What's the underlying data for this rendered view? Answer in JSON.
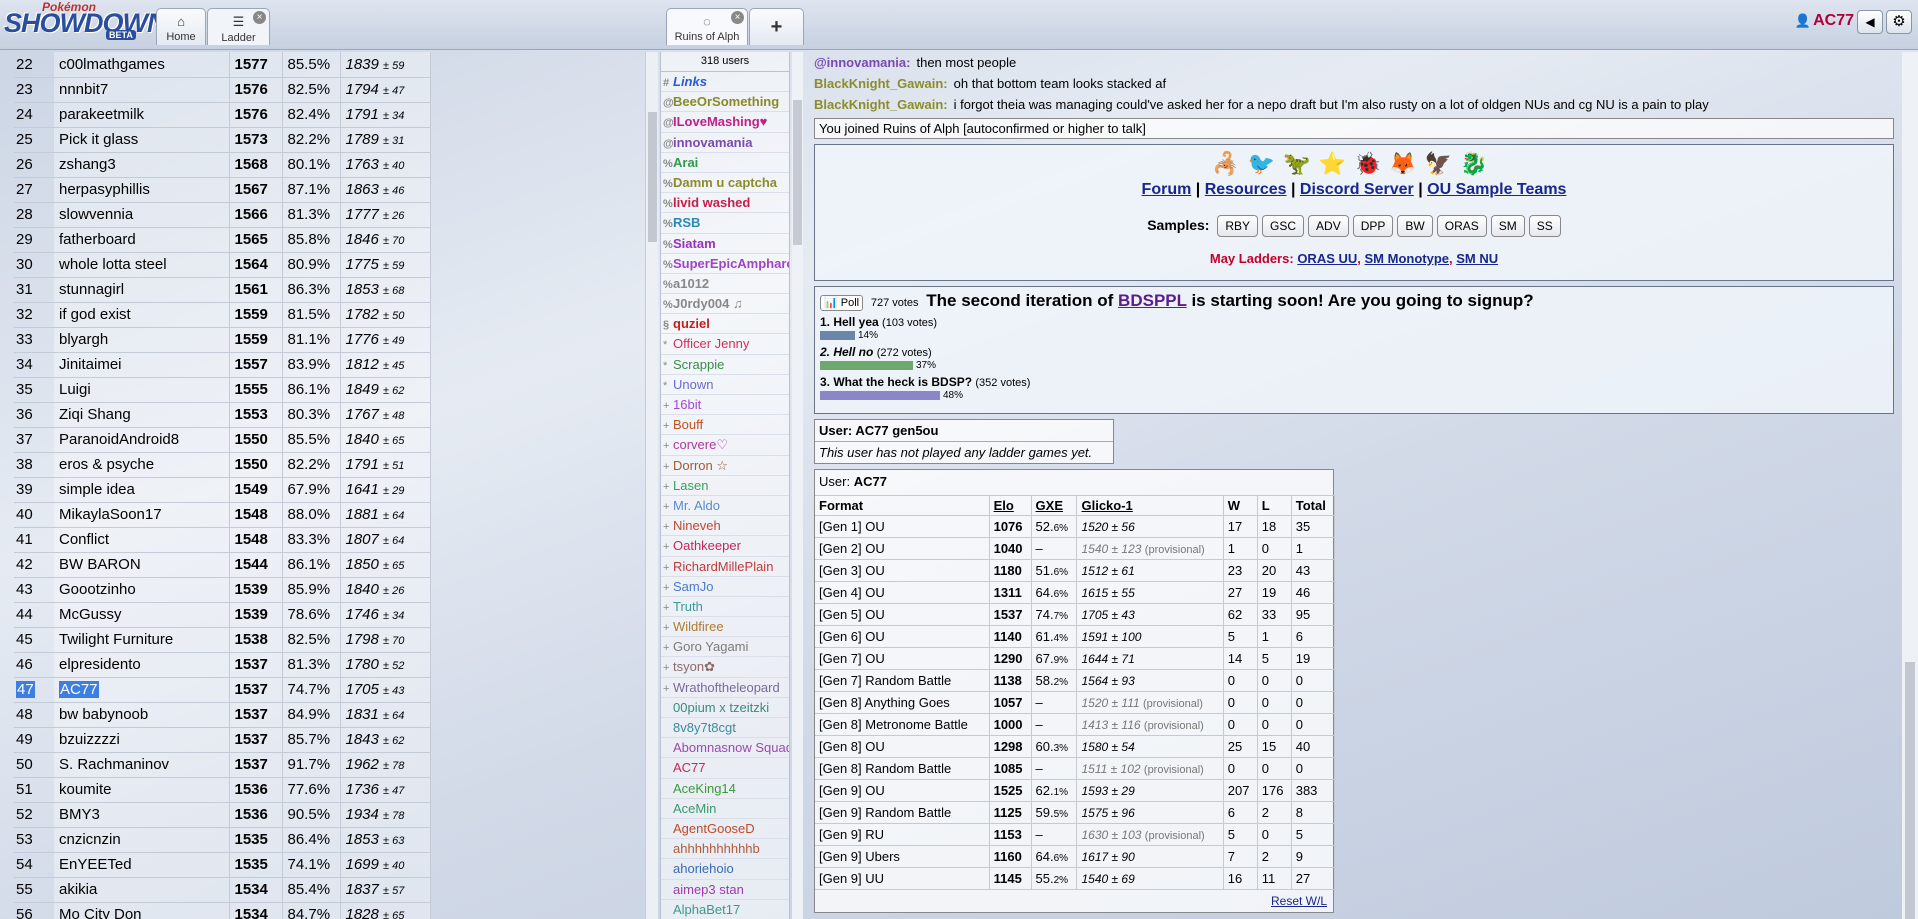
{
  "header": {
    "logo": {
      "pokemon": "Pokémon",
      "showdown": "SHOWDOWN",
      "beta": "BETA"
    },
    "tabs": {
      "home": {
        "icon": "⌂",
        "label": "Home"
      },
      "ladder": {
        "icon": "☰",
        "label": "Ladder",
        "close": "×"
      },
      "room": {
        "icon": "◌",
        "label": "Ruins of Alph",
        "close": "×"
      },
      "new_tab": "+"
    },
    "username": "AC77",
    "volume_icon": "◀",
    "gear_icon": "⚙"
  },
  "ladder": {
    "rows": [
      {
        "rank": "22",
        "name": "c00lmathgames",
        "elo": "1577",
        "gxe": "85.5%",
        "glicko": "1839",
        "dev": "± 59"
      },
      {
        "rank": "23",
        "name": "nnnbit7",
        "elo": "1576",
        "gxe": "82.5%",
        "glicko": "1794",
        "dev": "± 47"
      },
      {
        "rank": "24",
        "name": "parakeetmilk",
        "elo": "1576",
        "gxe": "82.4%",
        "glicko": "1791",
        "dev": "± 34"
      },
      {
        "rank": "25",
        "name": "Pick it glass",
        "elo": "1573",
        "gxe": "82.2%",
        "glicko": "1789",
        "dev": "± 31"
      },
      {
        "rank": "26",
        "name": "zshang3",
        "elo": "1568",
        "gxe": "80.1%",
        "glicko": "1763",
        "dev": "± 40"
      },
      {
        "rank": "27",
        "name": "herpasyphillis",
        "elo": "1567",
        "gxe": "87.1%",
        "glicko": "1863",
        "dev": "± 46"
      },
      {
        "rank": "28",
        "name": "slowvennia",
        "elo": "1566",
        "gxe": "81.3%",
        "glicko": "1777",
        "dev": "± 26"
      },
      {
        "rank": "29",
        "name": "fatherboard",
        "elo": "1565",
        "gxe": "85.8%",
        "glicko": "1846",
        "dev": "± 70"
      },
      {
        "rank": "30",
        "name": "whole lotta steel",
        "elo": "1564",
        "gxe": "80.9%",
        "glicko": "1775",
        "dev": "± 59"
      },
      {
        "rank": "31",
        "name": "stunnagirl",
        "elo": "1561",
        "gxe": "86.3%",
        "glicko": "1853",
        "dev": "± 68"
      },
      {
        "rank": "32",
        "name": "if god exist",
        "elo": "1559",
        "gxe": "81.5%",
        "glicko": "1782",
        "dev": "± 50"
      },
      {
        "rank": "33",
        "name": "blyargh",
        "elo": "1559",
        "gxe": "81.1%",
        "glicko": "1776",
        "dev": "± 49"
      },
      {
        "rank": "34",
        "name": "Jinitaimei",
        "elo": "1557",
        "gxe": "83.9%",
        "glicko": "1812",
        "dev": "± 45"
      },
      {
        "rank": "35",
        "name": "Luigi",
        "elo": "1555",
        "gxe": "86.1%",
        "glicko": "1849",
        "dev": "± 62"
      },
      {
        "rank": "36",
        "name": "Ziqi Shang",
        "elo": "1553",
        "gxe": "80.3%",
        "glicko": "1767",
        "dev": "± 48"
      },
      {
        "rank": "37",
        "name": "ParanoidAndroid8",
        "elo": "1550",
        "gxe": "85.5%",
        "glicko": "1840",
        "dev": "± 65"
      },
      {
        "rank": "38",
        "name": "eros & psyche",
        "elo": "1550",
        "gxe": "82.2%",
        "glicko": "1791",
        "dev": "± 51"
      },
      {
        "rank": "39",
        "name": "simple idea",
        "elo": "1549",
        "gxe": "67.9%",
        "glicko": "1641",
        "dev": "± 29"
      },
      {
        "rank": "40",
        "name": "MikaylaSoon17",
        "elo": "1548",
        "gxe": "88.0%",
        "glicko": "1881",
        "dev": "± 64"
      },
      {
        "rank": "41",
        "name": "Conflict",
        "elo": "1548",
        "gxe": "83.3%",
        "glicko": "1807",
        "dev": "± 64"
      },
      {
        "rank": "42",
        "name": "BW BARON",
        "elo": "1544",
        "gxe": "86.1%",
        "glicko": "1850",
        "dev": "± 65"
      },
      {
        "rank": "43",
        "name": "Goootzinho",
        "elo": "1539",
        "gxe": "85.9%",
        "glicko": "1840",
        "dev": "± 26"
      },
      {
        "rank": "44",
        "name": "McGussy",
        "elo": "1539",
        "gxe": "78.6%",
        "glicko": "1746",
        "dev": "± 34"
      },
      {
        "rank": "45",
        "name": "Twilight Furniture",
        "elo": "1538",
        "gxe": "82.5%",
        "glicko": "1798",
        "dev": "± 70"
      },
      {
        "rank": "46",
        "name": "elpresidento",
        "elo": "1537",
        "gxe": "81.3%",
        "glicko": "1780",
        "dev": "± 52"
      },
      {
        "rank": "47",
        "name": "AC77",
        "elo": "1537",
        "gxe": "74.7%",
        "glicko": "1705",
        "dev": "± 43"
      },
      {
        "rank": "48",
        "name": "bw babynoob",
        "elo": "1537",
        "gxe": "84.9%",
        "glicko": "1831",
        "dev": "± 64"
      },
      {
        "rank": "49",
        "name": "bzuizzzzi",
        "elo": "1537",
        "gxe": "85.7%",
        "glicko": "1843",
        "dev": "± 62"
      },
      {
        "rank": "50",
        "name": "S. Rachmaninov",
        "elo": "1537",
        "gxe": "91.7%",
        "glicko": "1962",
        "dev": "± 78"
      },
      {
        "rank": "51",
        "name": "koumite",
        "elo": "1536",
        "gxe": "77.6%",
        "glicko": "1736",
        "dev": "± 47"
      },
      {
        "rank": "52",
        "name": "BMY3",
        "elo": "1536",
        "gxe": "90.5%",
        "glicko": "1934",
        "dev": "± 78"
      },
      {
        "rank": "53",
        "name": "cnzicnzin",
        "elo": "1535",
        "gxe": "86.4%",
        "glicko": "1853",
        "dev": "± 63"
      },
      {
        "rank": "54",
        "name": "EnYEETed",
        "elo": "1535",
        "gxe": "74.1%",
        "glicko": "1699",
        "dev": "± 40"
      },
      {
        "rank": "55",
        "name": "akikia",
        "elo": "1534",
        "gxe": "85.4%",
        "glicko": "1837",
        "dev": "± 57"
      },
      {
        "rank": "56",
        "name": "Mo City Don",
        "elo": "1534",
        "gxe": "84.7%",
        "glicko": "1828",
        "dev": "± 65"
      }
    ],
    "highlight_rank": "47"
  },
  "userlist": {
    "count": "318 users",
    "users": [
      {
        "g": "#",
        "name": "Links",
        "color": "#2a5bd6",
        "b": true,
        "i": true
      },
      {
        "g": "@",
        "name": "BeeOrSomething",
        "color": "#8a8a26",
        "b": true
      },
      {
        "g": "@",
        "name": "ILoveMashing♥",
        "color": "#c0208a",
        "b": true
      },
      {
        "g": "@",
        "name": "innovamania",
        "color": "#7a4ab0",
        "b": true
      },
      {
        "g": "%",
        "name": "Arai",
        "color": "#2f9a4e",
        "b": true
      },
      {
        "g": "%",
        "name": "Damm u captcha",
        "color": "#8c8c2a",
        "b": true
      },
      {
        "g": "%",
        "name": "livid washed",
        "color": "#c41e4a",
        "b": true
      },
      {
        "g": "%",
        "name": "RSB",
        "color": "#2a8ab0",
        "b": true
      },
      {
        "g": "%",
        "name": "Siatam",
        "color": "#9a30b8",
        "b": true
      },
      {
        "g": "%",
        "name": "SuperEpicAmpharos",
        "color": "#a044c4",
        "b": true
      },
      {
        "g": "%",
        "name": "a1012",
        "color": "#888888",
        "b": true
      },
      {
        "g": "%",
        "name": "J0rdy004 ♫",
        "color": "#888888",
        "b": true
      },
      {
        "g": "§",
        "name": "quziel",
        "color": "#c41e1e",
        "b": true
      },
      {
        "g": "*",
        "name": "Officer Jenny",
        "color": "#d0305a",
        "b": false
      },
      {
        "g": "*",
        "name": "Scrappie",
        "color": "#3a8a4a",
        "b": false
      },
      {
        "g": "*",
        "name": "Unown",
        "color": "#6a6ad0",
        "b": false
      },
      {
        "g": "+",
        "name": "16bit",
        "color": "#a04ad0",
        "b": false
      },
      {
        "g": "+",
        "name": "Bouff",
        "color": "#c05020",
        "b": false
      },
      {
        "g": "+",
        "name": "corvere♡",
        "color": "#b03a9a",
        "b": false
      },
      {
        "g": "+",
        "name": "Dorron ☆",
        "color": "#a05a30",
        "b": false
      },
      {
        "g": "+",
        "name": "Lasen",
        "color": "#3aa060",
        "b": false
      },
      {
        "g": "+",
        "name": "Mr. Aldo",
        "color": "#5a8ad0",
        "b": false
      },
      {
        "g": "+",
        "name": "Nineveh",
        "color": "#c04a30",
        "b": false
      },
      {
        "g": "+",
        "name": "Oathkeeper",
        "color": "#c02a5a",
        "b": false
      },
      {
        "g": "+",
        "name": "RichardMillePlain",
        "color": "#c03a3a",
        "b": false
      },
      {
        "g": "+",
        "name": "SamJo",
        "color": "#4a7ad0",
        "b": false
      },
      {
        "g": "+",
        "name": "Truth",
        "color": "#3a9a9a",
        "b": false
      },
      {
        "g": "+",
        "name": "Wildfiree",
        "color": "#b07a30",
        "b": false
      },
      {
        "g": "+",
        "name": "Goro Yagami",
        "color": "#7a7a7a",
        "b": false
      },
      {
        "g": "+",
        "name": "tsyon✿",
        "color": "#8a6a6a",
        "b": false
      },
      {
        "g": "+",
        "name": "Wrathoftheleopard",
        "color": "#7a6a9a",
        "b": false
      },
      {
        "g": " ",
        "name": "00pium x tzeitzki",
        "color": "#3a8a7a",
        "b": false
      },
      {
        "g": " ",
        "name": "8v8y7t8cgt",
        "color": "#3a8aa0",
        "b": false
      },
      {
        "g": " ",
        "name": "Abomnasnow Squad",
        "color": "#9a4ab0",
        "b": false
      },
      {
        "g": " ",
        "name": "AC77",
        "color": "#c02a5a",
        "b": false
      },
      {
        "g": " ",
        "name": "AceKing14",
        "color": "#3a9a3a",
        "b": false
      },
      {
        "g": " ",
        "name": "AceMin",
        "color": "#3a9a6a",
        "b": false
      },
      {
        "g": " ",
        "name": "AgentGooseD",
        "color": "#c04a2a",
        "b": false
      },
      {
        "g": " ",
        "name": "ahhhhhhhhhhb",
        "color": "#b05a3a",
        "b": false
      },
      {
        "g": " ",
        "name": "ahoriehoio",
        "color": "#3a6ab0",
        "b": false
      },
      {
        "g": " ",
        "name": "aimep3 stan",
        "color": "#a03ab0",
        "b": false
      },
      {
        "g": " ",
        "name": "AlphaBet17",
        "color": "#3a9a8a",
        "b": false
      }
    ]
  },
  "chat": {
    "messages": [
      {
        "who": "@innovamania:",
        "color": "#7a4ab0",
        "text": "then most people"
      },
      {
        "who": "BlackKnight_Gawain:",
        "color": "#8c8c2a",
        "text": "oh that bottom team looks stacked af"
      },
      {
        "who": "BlackKnight_Gawain:",
        "color": "#8c8c2a",
        "text": "i forgot theia was managing could've asked her for a nepo draft but I'm also rusty on a lot of oldgen NUs and cg NU is a pain to play"
      }
    ],
    "joined_notice": "You joined Ruins of Alph [autoconfirmed or higher to talk]",
    "intro": {
      "sprites": [
        "🦂",
        "🐦",
        "🦖",
        "⭐",
        "🐞",
        "🦊",
        "🦅",
        "🐉"
      ],
      "links": [
        "Forum",
        "Resources",
        "Discord Server",
        "OU Sample Teams"
      ],
      "sep": "|",
      "samples_label": "Samples:",
      "samples": [
        "RBY",
        "GSC",
        "ADV",
        "DPP",
        "BW",
        "ORAS",
        "SM",
        "SS"
      ],
      "may_label": "May Ladders:",
      "may_links": [
        "ORAS UU",
        "SM Monotype",
        "SM NU"
      ],
      "comma": ","
    },
    "poll": {
      "badge": "📊 Poll",
      "votes": "727 votes",
      "q1": "The second iteration of",
      "q_link": "BDSPPL",
      "q2": "is starting soon! Are you going to signup?",
      "options": [
        {
          "label": "1. Hell yea",
          "votes": "(103 votes)",
          "pct": "14%",
          "frac": 0.14,
          "color": "#6a86a8",
          "italic": false
        },
        {
          "label": "2. Hell no",
          "votes": "(272 votes)",
          "pct": "37%",
          "frac": 0.37,
          "color": "#6fa86f",
          "italic": true
        },
        {
          "label": "3. What the heck is BDSP?",
          "votes": "(352 votes)",
          "pct": "48%",
          "frac": 0.48,
          "color": "#8a86c8",
          "italic": false
        }
      ]
    },
    "user_gen5ou": {
      "title": "User: AC77 gen5ou",
      "empty": "This user has not played any ladder games yet."
    },
    "stats": {
      "title_prefix": "User:",
      "title_user": "AC77",
      "headers": [
        "Format",
        "Elo",
        "GXE",
        "Glicko-1",
        "W",
        "L",
        "Total"
      ],
      "rows": [
        {
          "format": "[Gen 1] OU",
          "elo": "1076",
          "gxe": "52.",
          "gxe_dec": "6%",
          "gl": "1520 ± 56",
          "prov": "",
          "w": "17",
          "l": "18",
          "t": "35"
        },
        {
          "format": "[Gen 2] OU",
          "elo": "1040",
          "gxe": "–",
          "gxe_dec": "",
          "gl": "1540 ± 123",
          "prov": "(provisional)",
          "w": "1",
          "l": "0",
          "t": "1"
        },
        {
          "format": "[Gen 3] OU",
          "elo": "1180",
          "gxe": "51.",
          "gxe_dec": "6%",
          "gl": "1512 ± 61",
          "prov": "",
          "w": "23",
          "l": "20",
          "t": "43"
        },
        {
          "format": "[Gen 4] OU",
          "elo": "1311",
          "gxe": "64.",
          "gxe_dec": "6%",
          "gl": "1615 ± 55",
          "prov": "",
          "w": "27",
          "l": "19",
          "t": "46"
        },
        {
          "format": "[Gen 5] OU",
          "elo": "1537",
          "gxe": "74.",
          "gxe_dec": "7%",
          "gl": "1705 ± 43",
          "prov": "",
          "w": "62",
          "l": "33",
          "t": "95"
        },
        {
          "format": "[Gen 6] OU",
          "elo": "1140",
          "gxe": "61.",
          "gxe_dec": "4%",
          "gl": "1591 ± 100",
          "prov": "",
          "w": "5",
          "l": "1",
          "t": "6"
        },
        {
          "format": "[Gen 7] OU",
          "elo": "1290",
          "gxe": "67.",
          "gxe_dec": "9%",
          "gl": "1644 ± 71",
          "prov": "",
          "w": "14",
          "l": "5",
          "t": "19"
        },
        {
          "format": "[Gen 7] Random Battle",
          "elo": "1138",
          "gxe": "58.",
          "gxe_dec": "2%",
          "gl": "1564 ± 93",
          "prov": "",
          "w": "0",
          "l": "0",
          "t": "0"
        },
        {
          "format": "[Gen 8] Anything Goes",
          "elo": "1057",
          "gxe": "–",
          "gxe_dec": "",
          "gl": "1520 ± 111",
          "prov": "(provisional)",
          "w": "0",
          "l": "0",
          "t": "0"
        },
        {
          "format": "[Gen 8] Metronome Battle",
          "elo": "1000",
          "gxe": "–",
          "gxe_dec": "",
          "gl": "1413 ± 116",
          "prov": "(provisional)",
          "w": "0",
          "l": "0",
          "t": "0"
        },
        {
          "format": "[Gen 8] OU",
          "elo": "1298",
          "gxe": "60.",
          "gxe_dec": "3%",
          "gl": "1580 ± 54",
          "prov": "",
          "w": "25",
          "l": "15",
          "t": "40"
        },
        {
          "format": "[Gen 8] Random Battle",
          "elo": "1085",
          "gxe": "–",
          "gxe_dec": "",
          "gl": "1511 ± 102",
          "prov": "(provisional)",
          "w": "0",
          "l": "0",
          "t": "0"
        },
        {
          "format": "[Gen 9] OU",
          "elo": "1525",
          "gxe": "62.",
          "gxe_dec": "1%",
          "gl": "1593 ± 29",
          "prov": "",
          "w": "207",
          "l": "176",
          "t": "383"
        },
        {
          "format": "[Gen 9] Random Battle",
          "elo": "1125",
          "gxe": "59.",
          "gxe_dec": "5%",
          "gl": "1575 ± 96",
          "prov": "",
          "w": "6",
          "l": "2",
          "t": "8"
        },
        {
          "format": "[Gen 9] RU",
          "elo": "1153",
          "gxe": "–",
          "gxe_dec": "",
          "gl": "1630 ± 103",
          "prov": "(provisional)",
          "w": "5",
          "l": "0",
          "t": "5"
        },
        {
          "format": "[Gen 9] Ubers",
          "elo": "1160",
          "gxe": "64.",
          "gxe_dec": "6%",
          "gl": "1617 ± 90",
          "prov": "",
          "w": "7",
          "l": "2",
          "t": "9"
        },
        {
          "format": "[Gen 9] UU",
          "elo": "1145",
          "gxe": "55.",
          "gxe_dec": "2%",
          "gl": "1540 ± 69",
          "prov": "",
          "w": "16",
          "l": "11",
          "t": "27"
        }
      ],
      "reset": "Reset W/L"
    }
  }
}
